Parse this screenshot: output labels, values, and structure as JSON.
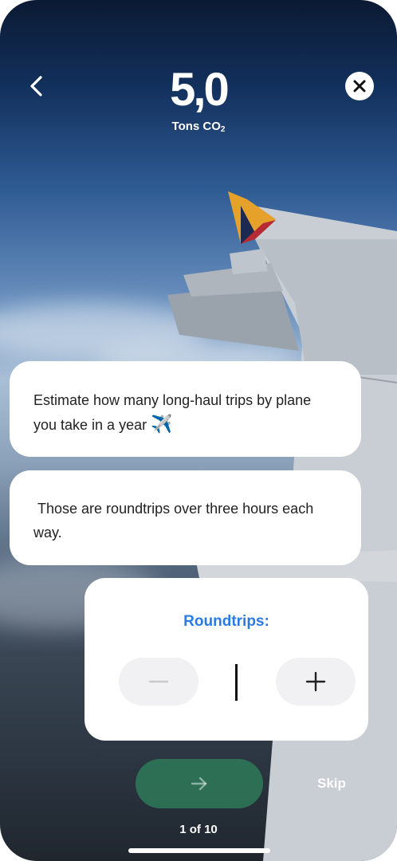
{
  "header": {
    "back_icon": "chevron-left-icon",
    "close_icon": "close-icon",
    "score_value": "5,0",
    "score_unit_prefix": "Tons CO",
    "score_unit_sub": "2"
  },
  "messages": [
    {
      "text": "Estimate how many long-haul trips by plane you take in a year",
      "emoji": "✈️"
    },
    {
      "text": " Those are roundtrips over three hours each way."
    }
  ],
  "input_card": {
    "title": "Roundtrips:",
    "title_color": "#2a7be4",
    "value": "",
    "decrement_icon": "minus-icon",
    "increment_icon": "plus-icon"
  },
  "footer": {
    "next_icon": "arrow-right-icon",
    "next_button_color": "#2e7d5a",
    "skip_label": "Skip",
    "progress_text": "1 of 10"
  }
}
